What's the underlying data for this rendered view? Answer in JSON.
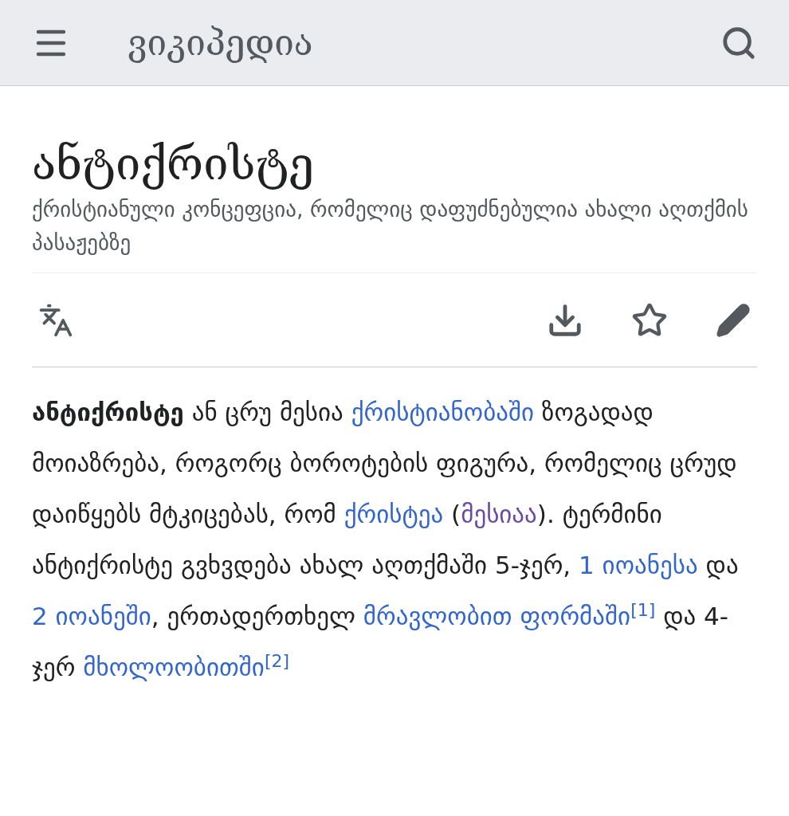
{
  "header": {
    "logo": "ვიკიპედია"
  },
  "article": {
    "title": "ანტიქრისტე",
    "description": "ქრისტიანული კონცეფცია, რომელიც დაფუძნებულია ახალი აღთქმის პასაჟებზე",
    "paragraph": [
      {
        "kind": "bold",
        "text": "ანტიქრისტე"
      },
      {
        "kind": "plain",
        "text": " ან ცრუ მესია "
      },
      {
        "kind": "link",
        "text": "ქრისტიანობაში",
        "visited": false
      },
      {
        "kind": "plain",
        "text": " ზოგადად მოიაზრება, როგორც ბოროტების ფიგურა, რომელიც ცრუდ დაიწყებს მტკიცებას, რომ "
      },
      {
        "kind": "link",
        "text": "ქრისტეა",
        "visited": false
      },
      {
        "kind": "plain",
        "text": " ("
      },
      {
        "kind": "link",
        "text": "მესიაა",
        "visited": true
      },
      {
        "kind": "plain",
        "text": "). ტერმინი ანტიქრისტე გვხვდება ახალ აღთქმაში 5-ჯერ, "
      },
      {
        "kind": "link",
        "text": "1 იოანესა",
        "visited": false
      },
      {
        "kind": "plain",
        "text": " და "
      },
      {
        "kind": "link",
        "text": "2 იოანეში",
        "visited": false
      },
      {
        "kind": "plain",
        "text": ", ერთადერთხელ "
      },
      {
        "kind": "link",
        "text": "მრავლობით ფორმაში",
        "visited": false
      },
      {
        "kind": "ref",
        "text": "[1]",
        "visited": false
      },
      {
        "kind": "plain",
        "text": " და 4-ჯერ "
      },
      {
        "kind": "link",
        "text": "მხოლოობითში",
        "visited": false
      },
      {
        "kind": "ref",
        "text": "[2]",
        "visited": false
      }
    ]
  }
}
